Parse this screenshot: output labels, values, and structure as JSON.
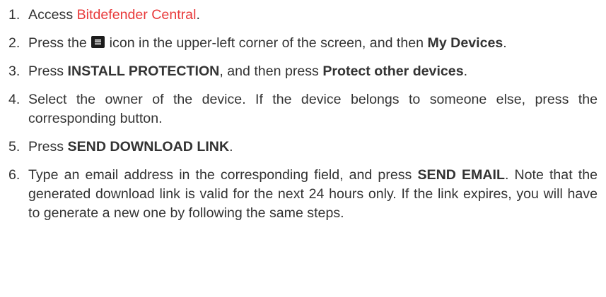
{
  "steps": [
    {
      "num": "1.",
      "p1": "Access ",
      "link": "Bitdefender Central",
      "p2": "."
    },
    {
      "num": "2.",
      "p1": "Press the ",
      "icon": "menu-icon",
      "p2": " icon in the upper-left corner of the screen, and then ",
      "b1": "My Devices",
      "p3": "."
    },
    {
      "num": "3.",
      "p1": "Press ",
      "b1": "INSTALL PROTECTION",
      "p2": ", and then press ",
      "b2": "Protect other devices",
      "p3": "."
    },
    {
      "num": "4.",
      "p1": "Select the owner of the device. If the device belongs to someone else, press the corresponding button."
    },
    {
      "num": "5.",
      "p1": "Press ",
      "b1": "SEND DOWNLOAD LINK",
      "p2": "."
    },
    {
      "num": "6.",
      "p1": "Type an email address in the corresponding field, and press ",
      "b1": "SEND EMAIL",
      "p2": ". Note that the generated download link is valid for the next 24 hours only. If the link expires, you will have to generate a new one by following the same steps."
    }
  ],
  "colors": {
    "link": "#e8393a",
    "text": "#333333"
  }
}
